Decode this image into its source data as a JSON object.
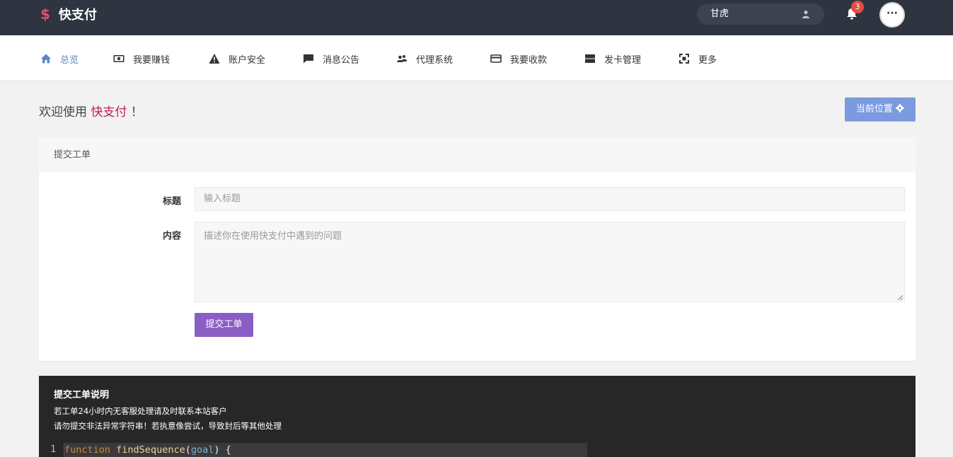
{
  "header": {
    "logo_symbol": "$",
    "logo_text": "快支付",
    "username": "甘虎",
    "notification_count": "3",
    "more_label": "···"
  },
  "nav": {
    "items": [
      {
        "label": "总览",
        "icon": "home-icon",
        "active": true
      },
      {
        "label": "我要赚钱",
        "icon": "money-icon"
      },
      {
        "label": "账户安全",
        "icon": "warning-icon"
      },
      {
        "label": "消息公告",
        "icon": "message-icon"
      },
      {
        "label": "代理系统",
        "icon": "users-icon"
      },
      {
        "label": "我要收款",
        "icon": "card-icon"
      },
      {
        "label": "发卡管理",
        "icon": "server-icon"
      },
      {
        "label": "更多",
        "icon": "expand-icon"
      }
    ]
  },
  "welcome": {
    "prefix": "欢迎使用",
    "brand": "快支付",
    "suffix": "！",
    "position_button": "当前位置"
  },
  "ticket": {
    "panel_title": "提交工单",
    "title_label": "标题",
    "title_placeholder": "输入标题",
    "content_label": "内容",
    "content_placeholder": "描述你在使用快支付中遇到的问题",
    "submit_label": "提交工单"
  },
  "info": {
    "title": "提交工单说明",
    "lines": [
      "若工单24小时内无客服处理请及时联系本站客户",
      "请勿提交非法异常字符串！若执意像尝试，导致封后等其他处理"
    ],
    "code": {
      "line_number": "1",
      "keyword": "function",
      "function_name": "findSequence",
      "open_paren": "(",
      "argument": "goal",
      "close": ") {"
    }
  },
  "colors": {
    "topbar": "#2e3440",
    "accent_brand": "#c2185b",
    "nav_active": "#5c87c9",
    "submit_button": "#8a5ec4",
    "position_button": "#7b9ae0",
    "badge": "#e74c3c"
  }
}
